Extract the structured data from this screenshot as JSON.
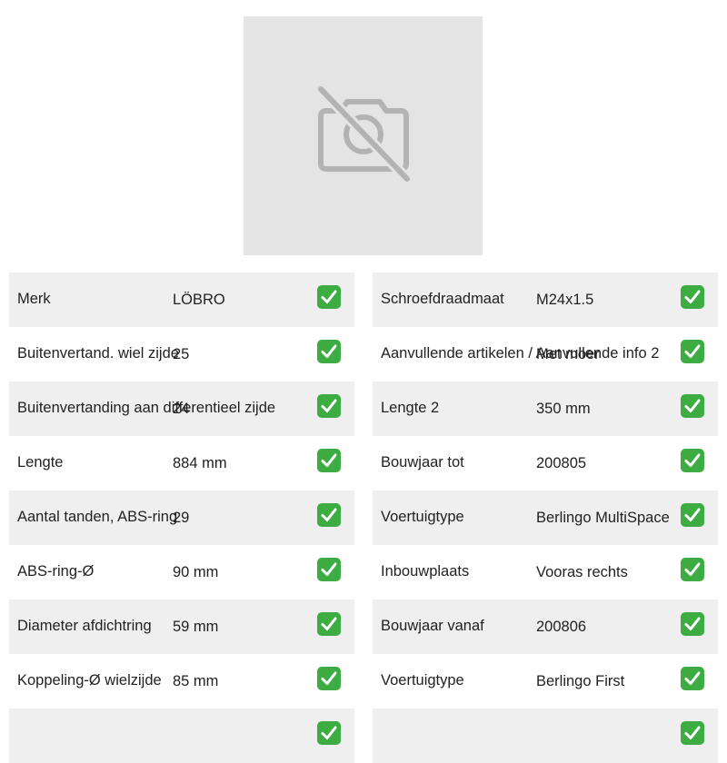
{
  "image": {
    "icon": "no-camera-icon"
  },
  "colors": {
    "check_green": "#3dac43",
    "row_shade": "#efefef",
    "placeholder_bg": "#e4e4e4"
  },
  "left_specs": [
    {
      "label": "Merk",
      "value": "LÖBRO"
    },
    {
      "label": "Buitenvertand. wiel zijde",
      "value": "25"
    },
    {
      "label": "Buitenvertanding aan differentieel zijde",
      "value": "24"
    },
    {
      "label": "Lengte",
      "value": "884 mm"
    },
    {
      "label": "Aantal tanden, ABS-ring",
      "value": "29"
    },
    {
      "label": "ABS-ring-Ø",
      "value": "90 mm"
    },
    {
      "label": "Diameter afdichtring",
      "value": "59 mm"
    },
    {
      "label": "Koppeling-Ø wielzijde",
      "value": "85 mm"
    },
    {
      "label": "",
      "value": ""
    }
  ],
  "right_specs": [
    {
      "label": "Schroefdraadmaat",
      "value": "M24x1.5"
    },
    {
      "label": "Aanvullende artikelen / Aanvullende info 2",
      "value": "Met moer"
    },
    {
      "label": "Lengte 2",
      "value": "350 mm"
    },
    {
      "label": "Bouwjaar tot",
      "value": "200805"
    },
    {
      "label": "Voertuigtype",
      "value": "Berlingo MultiSpace"
    },
    {
      "label": "Inbouwplaats",
      "value": "Vooras rechts"
    },
    {
      "label": "Bouwjaar vanaf",
      "value": "200806"
    },
    {
      "label": "Voertuigtype",
      "value": "Berlingo First"
    },
    {
      "label": "",
      "value": ""
    }
  ]
}
